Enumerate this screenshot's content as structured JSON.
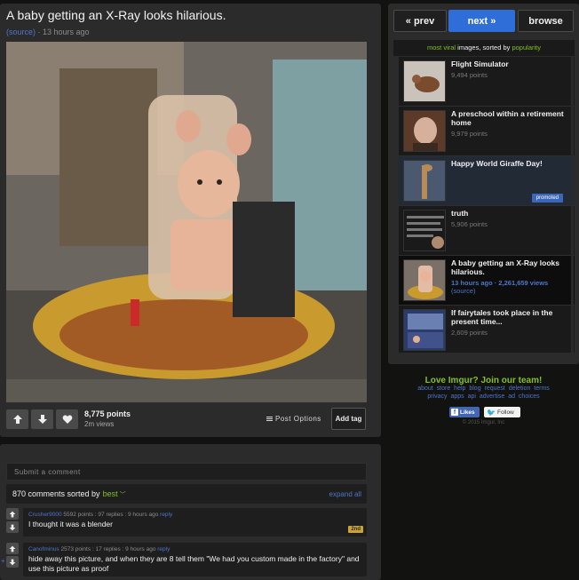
{
  "post": {
    "title": "A baby getting an X-Ray looks hilarious.",
    "source_link": "(source)",
    "time": " · 13 hours ago",
    "points": "8,775 points",
    "views": "2m views",
    "options_label": "Post Options",
    "add_tag_label": "Add tag"
  },
  "comments": {
    "input_placeholder": "Submit a comment",
    "count_label": "870 comments sorted by",
    "sort_value": "best",
    "expand_label": "expand all",
    "items": [
      {
        "author": "Crusher9000",
        "meta": " 5592 points : 97 replies : 9 hours ago ",
        "reply": "reply",
        "text": "I thought it was a blender",
        "badge": "2nd"
      },
      {
        "author": "Canofminus",
        "meta": " 2573 points : 17 replies : 9 hours ago ",
        "reply": "reply",
        "text": "hide away this picture, and when they are 8 tell them \"We had you custom made in the factory\" and use this picture as proof"
      }
    ]
  },
  "nav": {
    "prev_label": "« prev",
    "next_label": "next »",
    "browse_label": "browse"
  },
  "gallery": {
    "header_prefix": "most viral",
    "header_mid": " images, sorted by ",
    "header_sort": "popularity",
    "items": [
      {
        "title": "Flight Simulator",
        "points": "9,494 points"
      },
      {
        "title": "A preschool within a retirement home",
        "points": "9,979 points"
      },
      {
        "title": "Happy World Giraffe Day!",
        "badge": "promoted"
      },
      {
        "title": "truth",
        "points": "5,906 points"
      },
      {
        "title": "A baby getting an X-Ray looks hilarious.",
        "points": "13 hours ago · 2,261,659 views",
        "source": "(source)"
      },
      {
        "title": "If fairytales took place in the present time...",
        "points": "2,609 points"
      }
    ]
  },
  "footer": {
    "join_label": "Love Imgur? Join our team!",
    "row1": "about store help blog request deletion terms",
    "row2": "privacy apps api advertise ad choices",
    "fb_label": "Likes",
    "tw_label": "Follow",
    "copyright": "© 2015 Imgur, Inc"
  },
  "colors": {
    "accent_green": "#85bf25",
    "link_blue": "#4e76c9",
    "next_blue": "#2f6dd8"
  }
}
